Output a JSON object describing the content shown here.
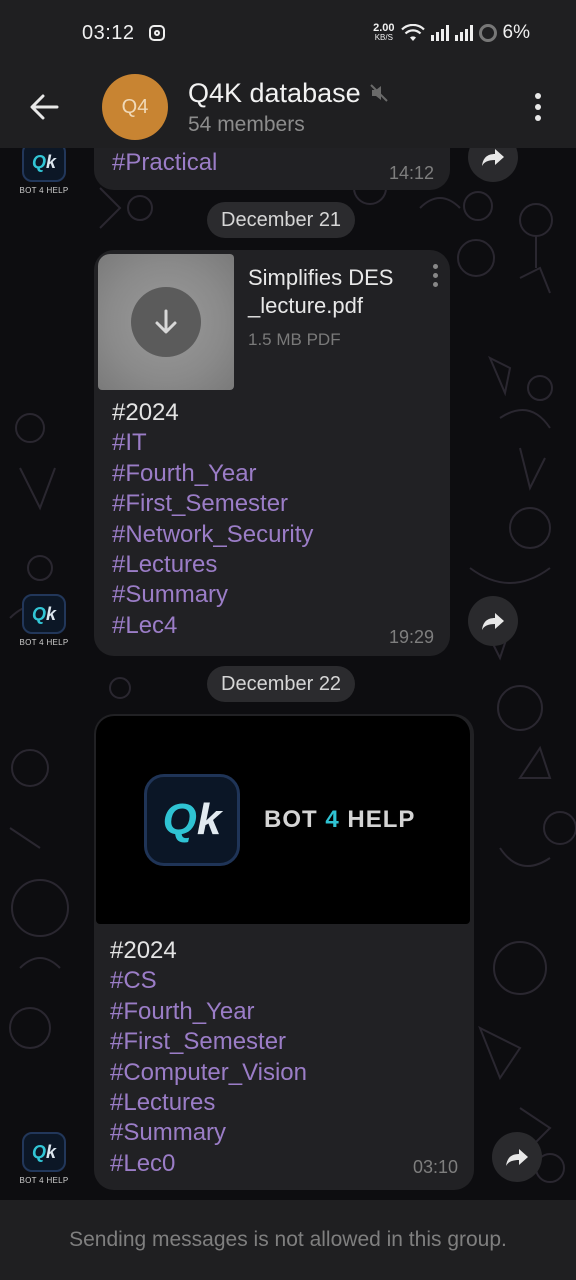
{
  "status_bar": {
    "time": "03:12",
    "net_speed_value": "2.00",
    "net_speed_unit": "KB/S",
    "battery": "6%"
  },
  "header": {
    "avatar_initials": "Q4",
    "title": "Q4K database",
    "subtitle": "54 members"
  },
  "bot": {
    "caption": "BOT 4 HELP",
    "logo_main": "Q",
    "logo_k": "k"
  },
  "messages": [
    {
      "tags": [
        "#Practical"
      ],
      "time": "14:12"
    },
    {
      "date": "December 21",
      "file": {
        "name": "Simplifies DES _lecture.pdf",
        "size": "1.5 MB PDF"
      },
      "first": "#2024",
      "tags": [
        "#IT",
        "#Fourth_Year",
        "#First_Semester",
        "#Network_Security",
        "#Lectures",
        "#Summary",
        "#Lec4"
      ],
      "time": "19:29"
    },
    {
      "date": "December 22",
      "banner_text_pre": "BOT ",
      "banner_text_four": "4",
      "banner_text_post": " HELP",
      "first": "#2024",
      "tags": [
        "#CS",
        "#Fourth_Year",
        "#First_Semester",
        "#Computer_Vision",
        "#Lectures",
        "#Summary",
        "#Lec0"
      ],
      "time": "03:10"
    }
  ],
  "footer": {
    "notice": "Sending messages is not allowed in this group."
  },
  "colors": {
    "hashtag": "#9b7dc7",
    "bubble": "#212124",
    "avatar": "#c88432",
    "brand_teal": "#2fc3d3"
  }
}
